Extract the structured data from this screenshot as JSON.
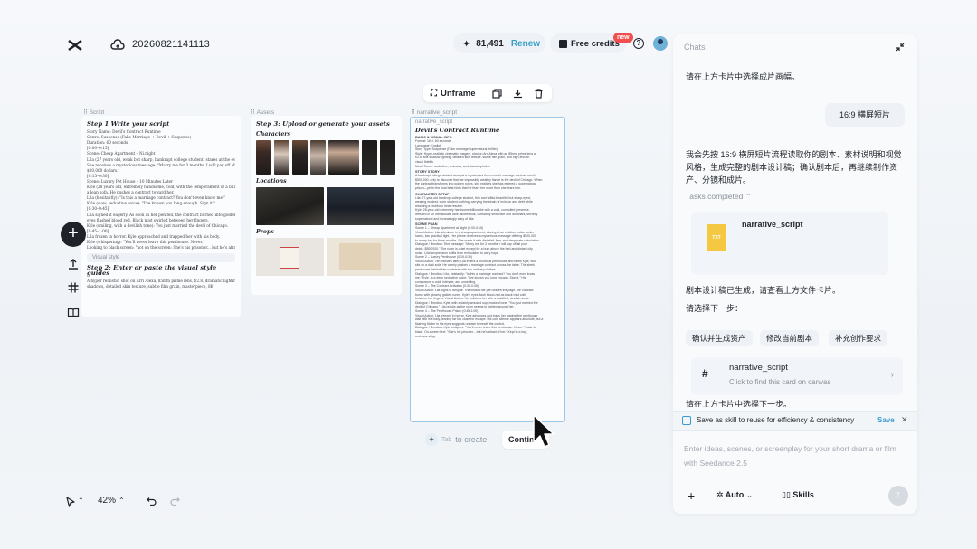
{
  "header": {
    "project_title": "20260821141113",
    "credits": "81,491",
    "renew_label": "Renew",
    "free_credits_label": "Free credits",
    "new_badge": "new",
    "help": "?"
  },
  "node_toolbar": {
    "unframe_label": "Unframe"
  },
  "panels": {
    "script": {
      "label": "Script",
      "step1_title": "Step 1 Write your script",
      "lines": [
        "Story Name: Devil's Contract Runtime",
        "Genre: Suspense (Fake Marriage + Devil + Suspense)",
        "Duration: 60 seconds",
        "[0:00–0:15]",
        "Scene: Cheap Apartment – Ni.night",
        "Lila (27 years old, weak but sharp, bankrupt college student) stares at the eviction notice.",
        "She receives a mysterious message: \"Marry me for 3 months. I will pay off all your debts.",
        "$30,000 dollars.\"",
        "[0:15–0:30]",
        "Scene: Luxury Pet House – 10 Minutes Later",
        "Kyle (28 years old, extremely handsome, cold, with the temperament of a billionaire) sits on",
        "a lean sofa. He pushes a contract toward her.",
        "Lila (hesitantly): \"Is this a marriage contract? You don't even know me.\"",
        "Kyle (slow, seductive voice): \"I've known you long enough. Sign it.\"",
        "[0:30–0:45]",
        "Lila signed it eagerly. As soon as her pen fell, the contract burned into golden ones. Kyle's",
        "eyes flashed blood red. Black mist swirled between her fingers.",
        "Kyle (smiling, with a devilish tone): You just married the devil of Chicago.",
        "[0:45–1:00]",
        "Lila frozen in horror. Kyle approached and trapped her with his body.",
        "Kyle (whispering): \"You'll never leave this penthouse. Never.\"",
        "Looking to black screen: \"not on the screen: She's his prisoner... but he's afraid of her.\""
      ],
      "visual_style_placeholder": "Visual style",
      "step2_title": "Step 2: Enter or paste the visual style guides",
      "step2_lines": [
        "A hyper realistic, shot on Arri Alexa, 85mm prime lens, f/2.8, dramatic lighting with soft",
        "shadows, detailed skin texture, subtle film grain, masterpiece, 8K"
      ]
    },
    "assets": {
      "label": "Assets",
      "step3_title": "Step 3: Upload or generate your assets",
      "characters_label": "Characters",
      "locations_label": "Locations",
      "props_label": "Props"
    },
    "narrative": {
      "label": "narrative_script",
      "overlay_label": "narrative_script",
      "title": "Devil's Contract Runtime",
      "basic_h": "BASIC & VISUAL INFO",
      "basic_lines": [
        "Format: 16:9, 60 seconds",
        "Language: English",
        "Story Type: Suspense (Fake marriage/supernatural thriller)",
        "Style: Hyper-realistic cinematic imagery, shot on Arri Alexa with an 85mm prime lens at",
        "f/2.8, soft shadow lighting, detailed skin texture, subtle film grain, and high-end 8K",
        "visual fidelity.",
        "Mood Tones: seductive, ominous, and claustrophobic."
      ],
      "story_h": "STORY STORY",
      "story_lines": [
        "A bankrupt college student accepts a mysterious three-month marriage contract worth",
        "$500,000, only to discover that her impossibly wealthy fiancé is the devil of Chicago. When",
        "the contract transforms into golden runes, she realizes she has entered a supernatural",
        "prison—yet in the final beat hints that he fears her more than she fears him."
      ],
      "char_h": "CHARACTER SETUP",
      "char_lines": [
        "Lila: 27-year-old bankrupt college student, thin and willful-beautiful but sharp-eyed,",
        "wearing modest, worn student clothing, carrying the strain of eviction and debt while",
        "retaining a stubborn inner resolve.",
        "Kyle: 28-year-old extremely handsome billionaire with a cold, controlled presence,",
        "dressed in an immaculate dark tailored suit, outwardly seductive and dominant, secretly",
        "supernatural and increasingly wary of Lila."
      ],
      "scene_h": "SCENE PLAN",
      "scene_lines": [
        "Scene 1 – Cheap Apartment at Night (0:00-0:15)",
        "Visual Action: Lila sits alone in a cheap apartment, staring at an eviction notice under",
        "harsh, low practical light. Her phone receives a mysterious message offering $500,000",
        "to marry her for three months. She reads it with disbelief, fear, and desperate calculation.",
        "Dialogue / Emotion: Text message: \"Marry me for 3 months. I will pay off all your",
        "debts. $500,000.\" The room is quiet except for a hum above the bed and distant city",
        "noise. Lila's expression shifts from exhaustion to wary hope.",
        "Scene 2 – Luxury Penthouse (0:15-0:30)",
        "Visual Action: Ten minutes later, Lila enters a luxurious penthouse and faces Kyle, who",
        "sits on a dark sofa. He calmly pushes a marriage contract across the table. The sleek",
        "penthouse behind him contrasts with her ordinary clothes.",
        "Dialogue / Emotion: Lila, hesitantly: \"Is this a marriage contract? You don't even know",
        "me.\" Kyle, in a deep seductive voice: \"I've known you long enough. Sign it.\" His",
        "composure is cold, intimate, and unsettling.",
        "Scene 3 – The Contract Activates (0:30-0:45)",
        "Visual Action: Lila signs in despair. The instant her pen leaves the page, the contract",
        "burns with glowing golden runes. Kyle's eyes flash blood-red as black mist coils",
        "between her fingers. Visual Action: He watches her with a satisfied, devilish smile.",
        "Dialogue / Emotion: Kyle, with a darkly amused supernatural tone: \"You just married the",
        "devil of Chicago.\" Lila recoils as the room seems to tighten around her.",
        "Scene 4 – The Penthouse Prison (0:45-1:00)",
        "Visual Action: Lila freezes in horror. Kyle advances and traps her against the penthouse",
        "wall with his body, leaning far too close for escape. His cold silence appears absolute, but a",
        "flashing flicker in his eyes suggests unease beneath the control.",
        "Dialogue / Emotion: Kyle whispers: \"You'll never leave this penthouse. Never.\" Fade to",
        "black. On-screen text: \"She's his prisoner... but he's afraid of her.\" Kept to a key,",
        "ominous sting."
      ]
    }
  },
  "canvas": {
    "tab_key": "Tab",
    "tab_create_label": "to create",
    "continue_label": "Contin",
    "zoom": "42%"
  },
  "chat": {
    "header": "Chats",
    "msg1": "请在上方卡片中选择成片画幅。",
    "user_msg": "16:9 横屏短片",
    "msg2": "我会先按 16:9 横屏短片流程读取你的剧本、素材说明和视觉风格，生成完整的剧本设计稿；确认剧本后，再继续制作资产、分镜和成片。",
    "tasks_completed": "Tasks completed",
    "file_name": "narrative_script",
    "file_type": "TXT",
    "msg3": "剧本设计稿已生成，请查看上方文件卡片。",
    "msg4": "请选择下一步：",
    "chips": [
      "确认并生成资产",
      "修改当前剧本",
      "补充创作要求"
    ],
    "canvas_card_name": "narrative_script",
    "canvas_card_sub": "Click to find this card on canvas",
    "msg5": "请在上方卡片中选择下一步。",
    "skill_bar_text": "Save as skill to reuse for efficiency & consistency",
    "skill_save": "Save",
    "input_placeholder": "Enter ideas, scenes, or screenplay for your short drama or film with Seedance 2.5",
    "auto_label": "Auto",
    "skills_label": "Skills"
  },
  "colors": {
    "accent": "#3aa0c8",
    "new_badge": "#f24e4e",
    "file_icon": "#f5c842",
    "selection_border": "#9cc7e6"
  }
}
